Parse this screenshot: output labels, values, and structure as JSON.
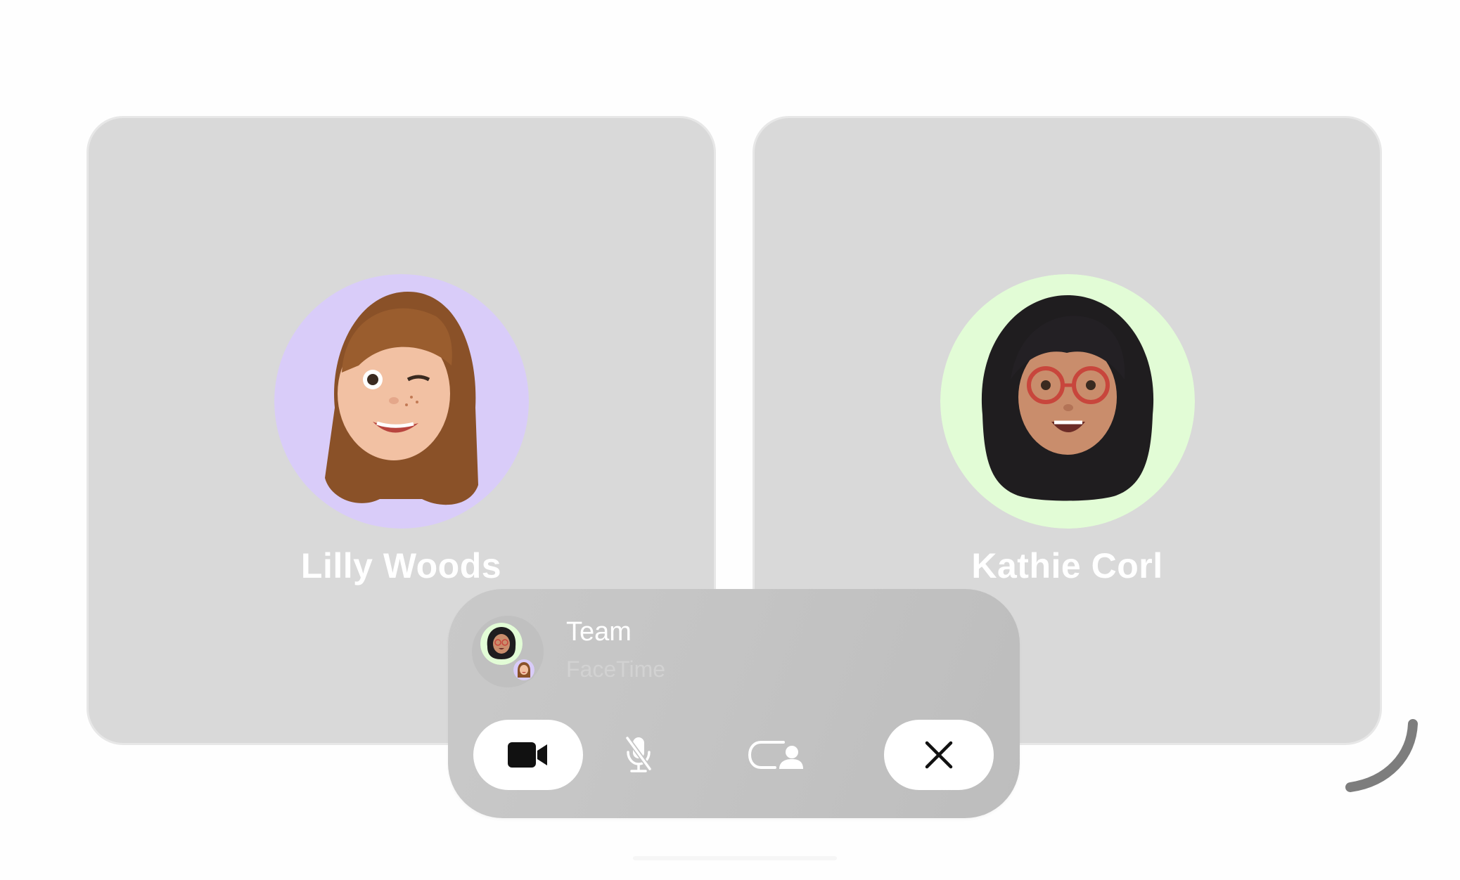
{
  "participants": [
    {
      "name": "Lilly Woods",
      "avatar_icon": "memoji-winking-avatar",
      "bg_color": "#d9ccf9"
    },
    {
      "name": "Kathie Corl",
      "avatar_icon": "memoji-glasses-avatar",
      "bg_color": "#e2fcd6"
    }
  ],
  "call": {
    "title": "Team",
    "subtitle": "FaceTime"
  },
  "controls": {
    "camera": {
      "icon": "video-camera-icon"
    },
    "mute": {
      "icon": "microphone-slash-icon"
    },
    "share": {
      "icon": "shareplay-person-icon"
    },
    "end": {
      "icon": "close-icon"
    }
  },
  "colors": {
    "tile_bg": "#d9d9d9",
    "panel_bg": "#c6c6c6",
    "name_text": "#ffffff",
    "icon_dark": "#111111"
  }
}
